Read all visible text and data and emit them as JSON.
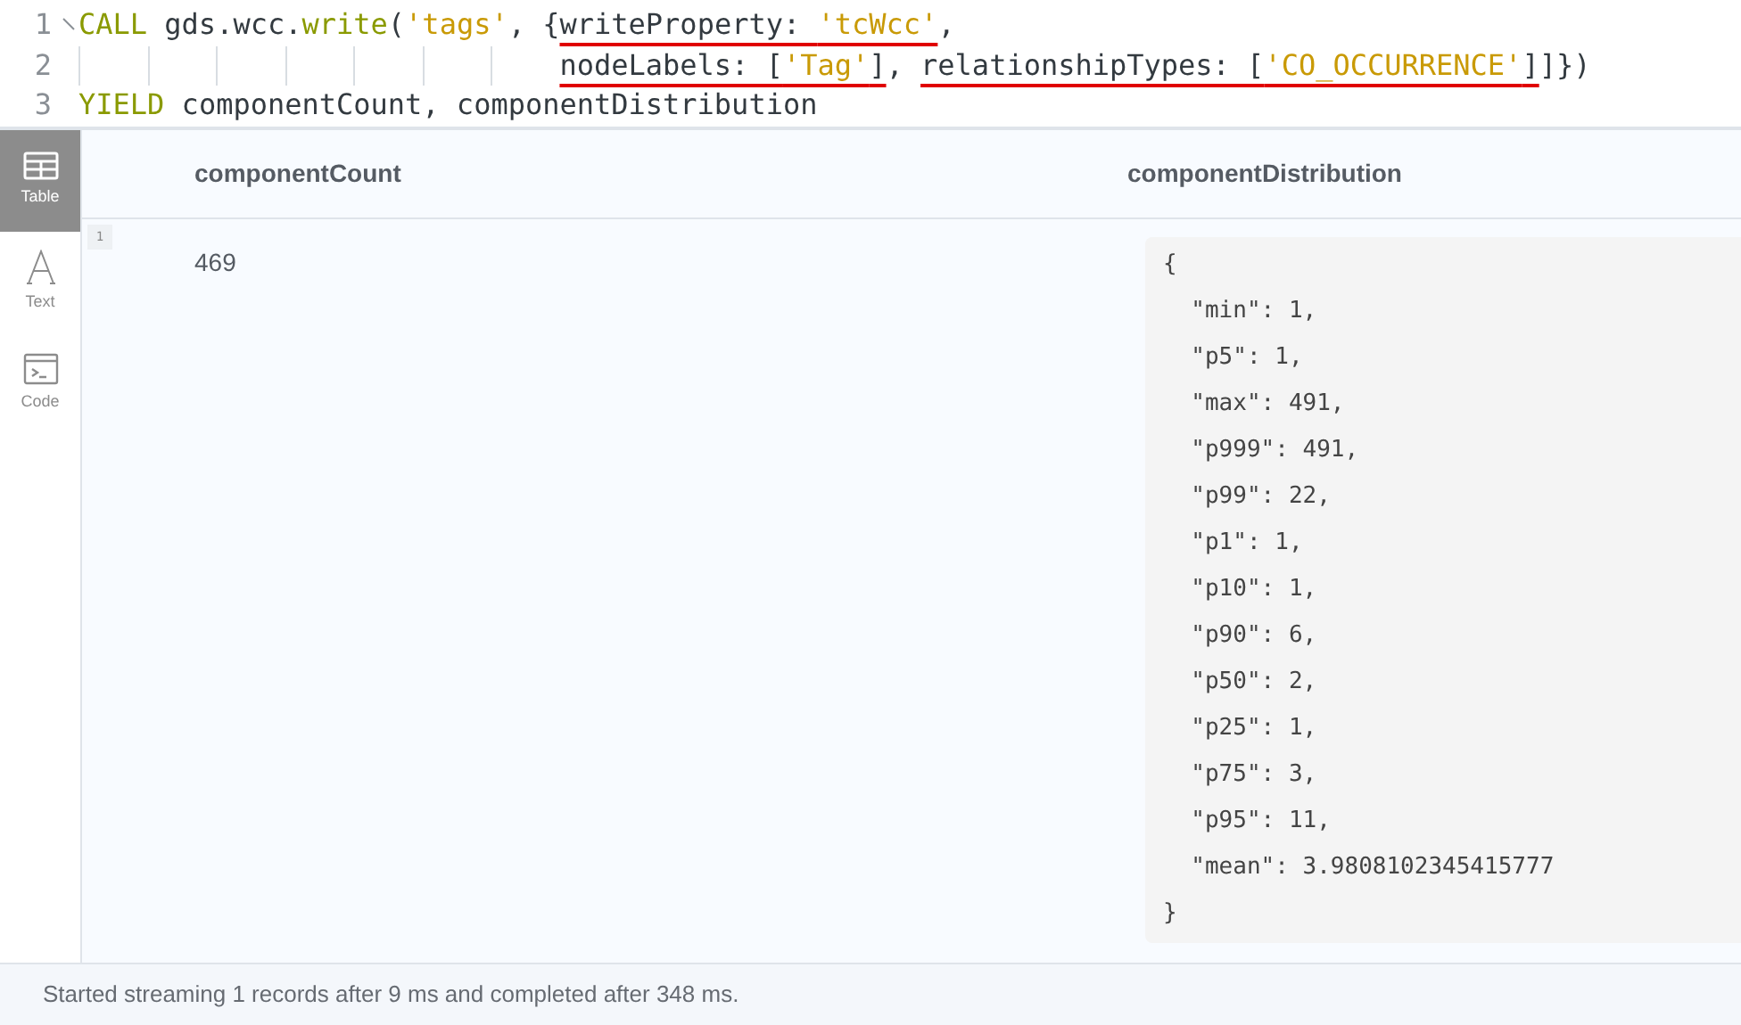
{
  "editor": {
    "lines": [
      {
        "number": "1",
        "tokens": [
          {
            "kind": "keyword",
            "text": "CALL",
            "underlined": false
          },
          {
            "kind": "plain",
            "text": " gds.wcc.",
            "underlined": false
          },
          {
            "kind": "function",
            "text": "write",
            "underlined": false
          },
          {
            "kind": "plain",
            "text": "(",
            "underlined": false
          },
          {
            "kind": "string",
            "text": "'tags'",
            "underlined": false
          },
          {
            "kind": "plain",
            "text": ", {",
            "underlined": false
          },
          {
            "kind": "property",
            "text": "writeProperty: ",
            "underlined": true
          },
          {
            "kind": "string",
            "text": "'tcWcc'",
            "underlined": true
          },
          {
            "kind": "plain",
            "text": ",",
            "underlined": false
          }
        ]
      },
      {
        "number": "2",
        "kind": "continuation",
        "tokens": [
          {
            "kind": "property",
            "text": "nodeLabels: [",
            "underlined": true
          },
          {
            "kind": "string",
            "text": "'Tag'",
            "underlined": true
          },
          {
            "kind": "plain",
            "text": "]",
            "underlined": true
          },
          {
            "kind": "plain",
            "text": ", ",
            "underlined": false
          },
          {
            "kind": "property",
            "text": "relationshipTypes: [",
            "underlined": true
          },
          {
            "kind": "string",
            "text": "'CO_OCCURRENCE'",
            "underlined": true
          },
          {
            "kind": "plain",
            "text": "]",
            "underlined": true
          },
          {
            "kind": "plain",
            "text": "]})",
            "underlined": false
          }
        ]
      },
      {
        "number": "3",
        "tokens": [
          {
            "kind": "keyword",
            "text": "YIELD",
            "underlined": false
          },
          {
            "kind": "plain",
            "text": " componentCount, componentDistribution",
            "underlined": false
          }
        ]
      }
    ]
  },
  "view_tabs": [
    {
      "label": "Table",
      "kind": "table",
      "selected": true
    },
    {
      "label": "Text",
      "kind": "text",
      "selected": false
    },
    {
      "label": "Code",
      "kind": "code",
      "selected": false
    }
  ],
  "table": {
    "columns": [
      "componentCount",
      "componentDistribution"
    ],
    "rows": [
      {
        "number": "1",
        "component_count": "469",
        "component_distribution": [
          "{",
          "  \"min\": 1,",
          "  \"p5\": 1,",
          "  \"max\": 491,",
          "  \"p999\": 491,",
          "  \"p99\": 22,",
          "  \"p1\": 1,",
          "  \"p10\": 1,",
          "  \"p90\": 6,",
          "  \"p50\": 2,",
          "  \"p25\": 1,",
          "  \"p75\": 3,",
          "  \"p95\": 11,",
          "  \"mean\": 3.9808102345415777",
          "}"
        ]
      }
    ]
  },
  "status_bar": "Started streaming 1 records after 9 ms and completed after 348 ms."
}
